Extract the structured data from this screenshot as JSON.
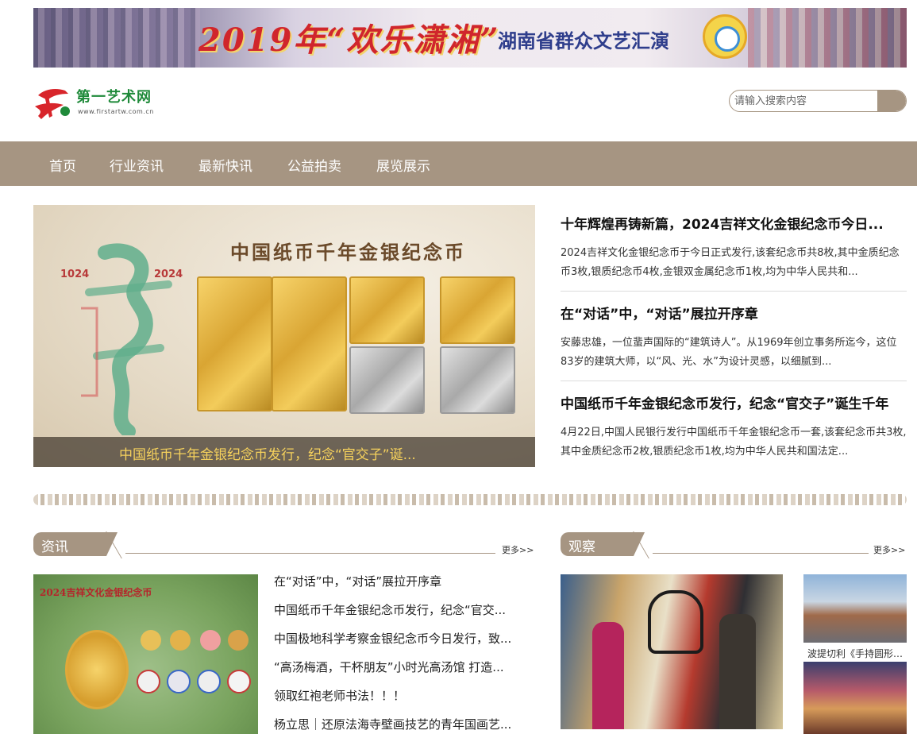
{
  "banner": {
    "title": "2019年“欢乐潇湘”",
    "subtitle": "湖南省群众文艺汇演"
  },
  "logo": {
    "name": "第一艺术网",
    "url": "www.firstartw.com.cn"
  },
  "search": {
    "placeholder": "请输入搜索内容"
  },
  "nav": {
    "items": [
      "首页",
      "行业资讯",
      "最新快讯",
      "公益拍卖",
      "展览展示"
    ]
  },
  "slider": {
    "image_title": "中国纸币千年金银纪念币",
    "year_left": "1024",
    "year_right": "2024",
    "caption": "中国纸币千年金银纪念币发行，纪念“官交子”诞..."
  },
  "featured_news": [
    {
      "title": "十年辉煌再铸新篇，2024吉祥文化金银纪念币今日...",
      "summary": "2024吉祥文化金银纪念币于今日正式发行,该套纪念币共8枚,其中金质纪念币3枚,银质纪念币4枚,金银双金属纪念币1枚,均为中华人民共和..."
    },
    {
      "title": "在“对话”中，“对话”展拉开序章",
      "summary": "安藤忠雄，一位蜚声国际的“建筑诗人”。从1969年创立事务所迄今，这位83岁的建筑大师，以“风、光、水”为设计灵感，以细腻到..."
    },
    {
      "title": "中国纸币千年金银纪念币发行，纪念“官交子”诞生千年",
      "summary": "4月22日,中国人民银行发行中国纸币千年金银纪念币一套,该套纪念币共3枚,其中金质纪念币2枚,银质纪念币1枚,均为中华人民共和国法定..."
    }
  ],
  "section_news": {
    "title": "资讯",
    "more": "更多>>",
    "image_title": "2024吉祥文化金银纪念币",
    "items": [
      "在“对话”中，“对话”展拉开序章",
      "中国纸币千年金银纪念币发行，纪念“官交...",
      "中国极地科学考察金银纪念币今日发行，致...",
      "“高汤梅酒，干杯朋友”小时光高汤馆 打造...",
      "领取红袍老师书法！！！",
      "杨立思｜还原法海寺壁画技艺的青年国画艺..."
    ]
  },
  "section_observe": {
    "title": "观察",
    "more": "更多>>",
    "thumbs": [
      {
        "caption": "波提切利《手持圆形圣..."
      }
    ]
  },
  "colors": {
    "brand": "#a69582",
    "caption_text": "#f5d15c"
  }
}
